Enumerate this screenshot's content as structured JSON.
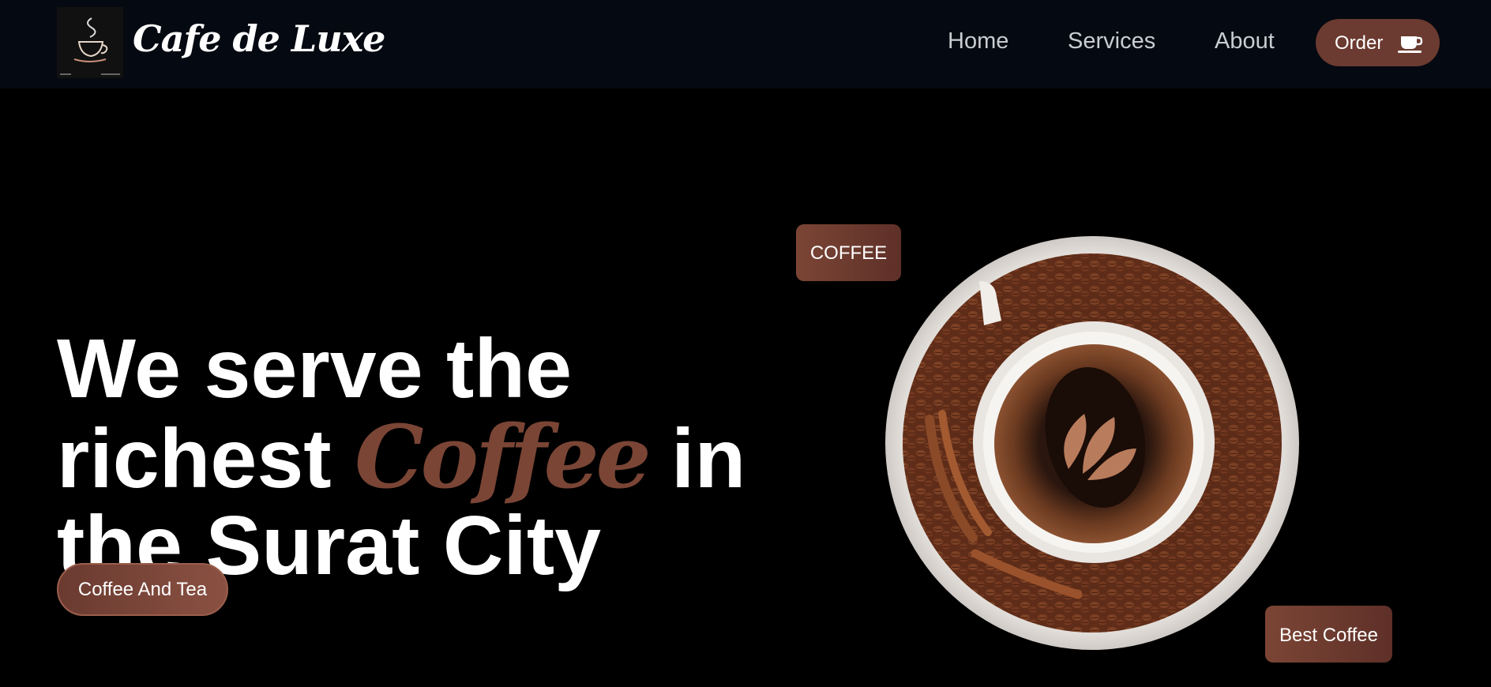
{
  "nav": {
    "brand": "Cafe de Luxe",
    "links": [
      "Home",
      "Services",
      "About"
    ],
    "order_label": "Order"
  },
  "hero": {
    "line1": "We serve the",
    "line2_pre": "richest",
    "line2_accent": "Coffee",
    "line2_post": "in",
    "line3": "the Surat City",
    "cta_label": "Coffee And Tea"
  },
  "tags": {
    "top": "COFFEE",
    "bottom": "Best Coffee"
  },
  "colors": {
    "nav_bg": "#050911",
    "accent": "#7a4535",
    "button": "#6b3a30"
  },
  "icons": {
    "order": "coffee-cup-icon",
    "logo": "steaming-cup-logo"
  }
}
